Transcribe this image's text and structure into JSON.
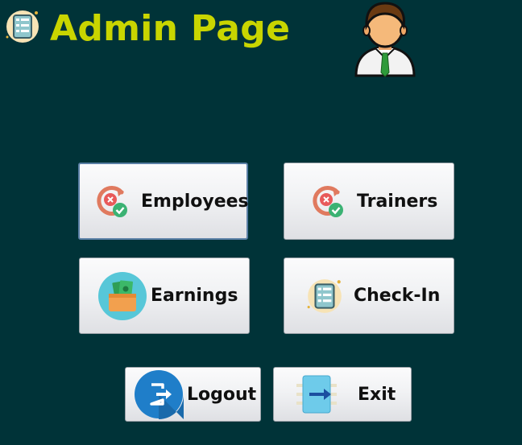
{
  "header": {
    "title": "Admin Page",
    "app_icon": "checklist-icon",
    "avatar_icon": "user-avatar-icon"
  },
  "buttons": {
    "employees": {
      "label": "Employees",
      "icon": "refresh-check-icon"
    },
    "trainers": {
      "label": "Trainers",
      "icon": "refresh-check-icon"
    },
    "earnings": {
      "label": "Earnings",
      "icon": "wallet-money-icon"
    },
    "checkin": {
      "label": "Check-In",
      "icon": "checklist-icon"
    },
    "logout": {
      "label": "Logout",
      "icon": "logout-icon"
    },
    "exit": {
      "label": "Exit",
      "icon": "exit-door-icon"
    }
  },
  "colors": {
    "background": "#003338",
    "title": "#c9d500",
    "button_text": "#101010",
    "focus_border": "#5a7fa5"
  }
}
